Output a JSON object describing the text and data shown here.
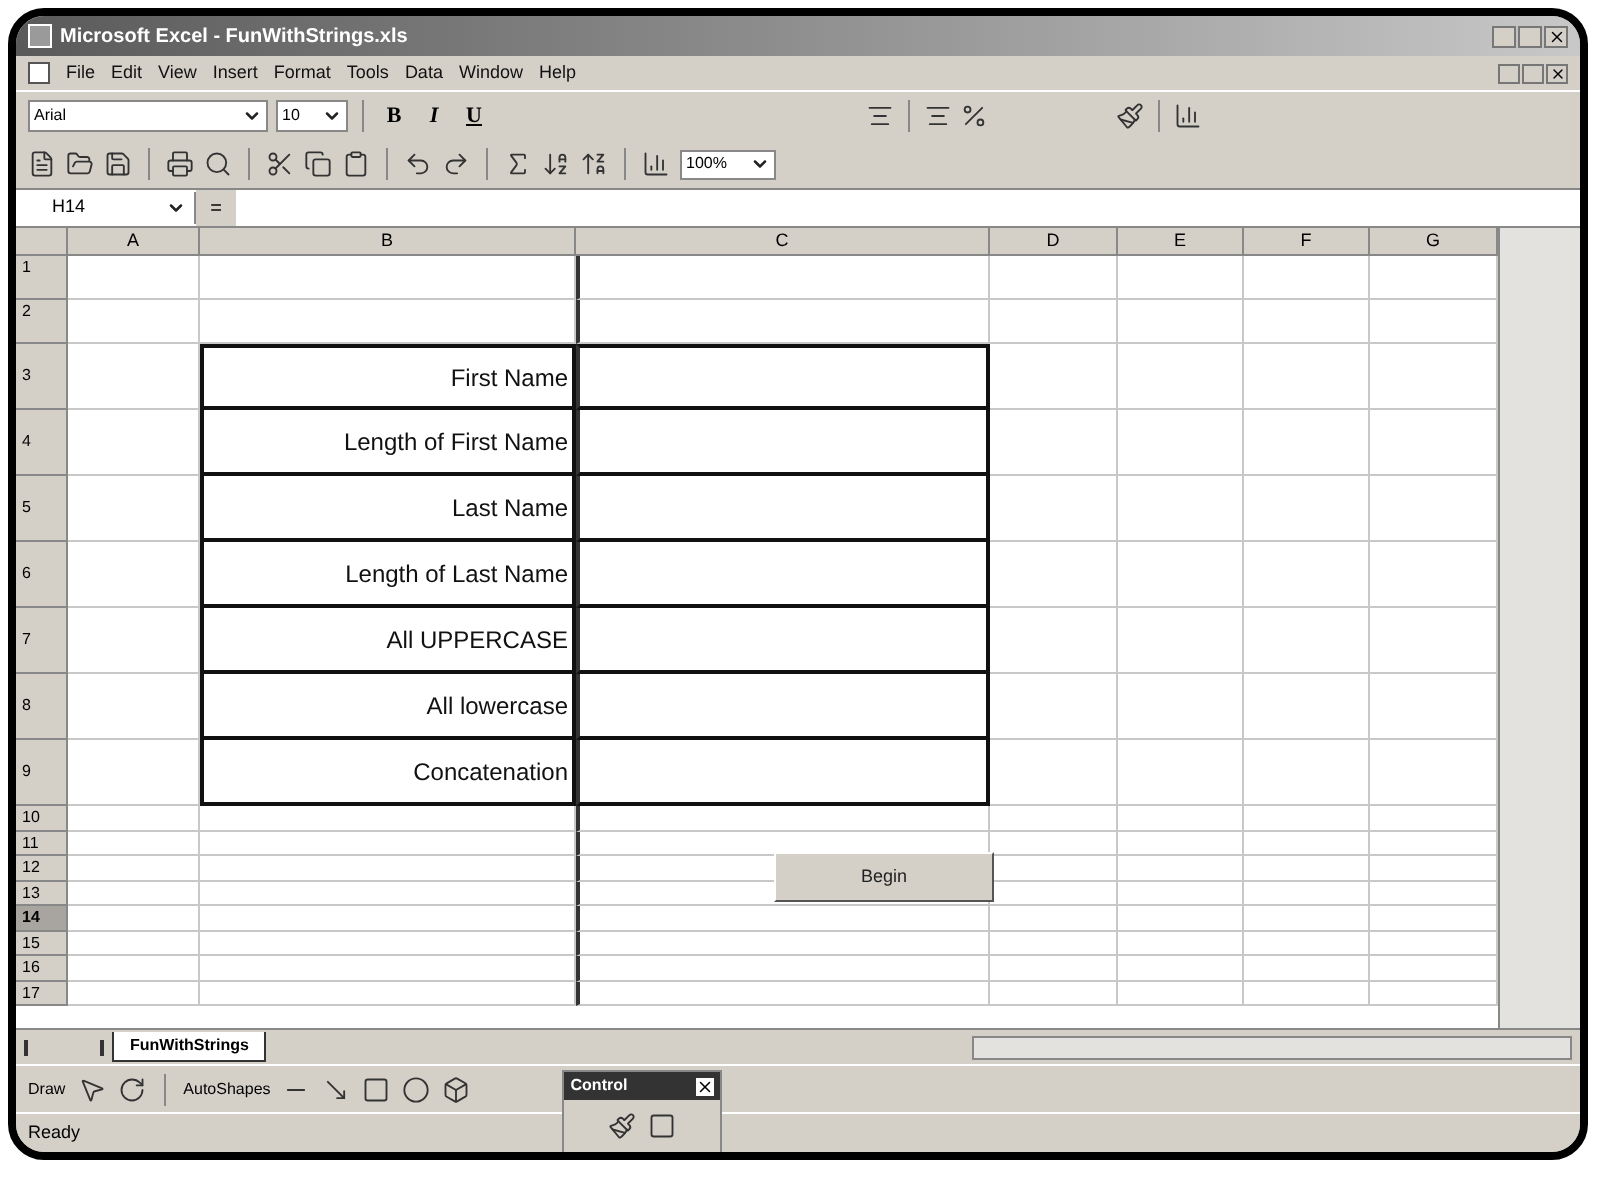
{
  "window": {
    "title": "Microsoft Excel - FunWithStrings.xls"
  },
  "menu": [
    "File",
    "Edit",
    "View",
    "Insert",
    "Format",
    "Tools",
    "Data",
    "Window",
    "Help"
  ],
  "formatting_toolbar": {
    "font": "Arial",
    "size": "10",
    "style_buttons": [
      "B",
      "I",
      "U"
    ]
  },
  "standard_toolbar": {
    "zoom": "100%"
  },
  "formula_bar": {
    "name_box": "H14",
    "equals": "="
  },
  "columns": [
    "A",
    "B",
    "C",
    "D",
    "E",
    "F",
    "G"
  ],
  "rows": [
    {
      "number": "1",
      "bordered": false,
      "selected": false
    },
    {
      "number": "2",
      "bordered": false,
      "selected": false
    },
    {
      "number": "3",
      "label": "First Name",
      "bordered": true,
      "selected": false
    },
    {
      "number": "4",
      "label": "Length of First Name",
      "bordered": true,
      "selected": false
    },
    {
      "number": "5",
      "label": "Last Name",
      "bordered": true,
      "selected": false
    },
    {
      "number": "6",
      "label": "Length of Last Name",
      "bordered": true,
      "selected": false
    },
    {
      "number": "7",
      "label": "All UPPERCASE",
      "bordered": true,
      "selected": false
    },
    {
      "number": "8",
      "label": "All lowercase",
      "bordered": true,
      "selected": false
    },
    {
      "number": "9",
      "label": "Concatenation",
      "bordered": true,
      "selected": false
    },
    {
      "number": "10",
      "bordered": false,
      "selected": false
    },
    {
      "number": "11",
      "bordered": false,
      "selected": false
    },
    {
      "number": "12",
      "bordered": false,
      "selected": false
    },
    {
      "number": "13",
      "bordered": false,
      "selected": false
    },
    {
      "number": "14",
      "bordered": false,
      "selected": true
    },
    {
      "number": "15",
      "bordered": false,
      "selected": false
    },
    {
      "number": "16",
      "bordered": false,
      "selected": false
    },
    {
      "number": "17",
      "bordered": false,
      "selected": false
    }
  ],
  "begin_button": {
    "label": "Begin"
  },
  "sheet_tabs": [
    {
      "label": "FunWithStrings",
      "selected": true
    }
  ],
  "drawing_toolbar": {
    "draw": "Draw",
    "autoshapes": "AutoShapes"
  },
  "control_toolbar": {
    "title": "Control"
  },
  "status_bar": {
    "text": "Ready"
  }
}
